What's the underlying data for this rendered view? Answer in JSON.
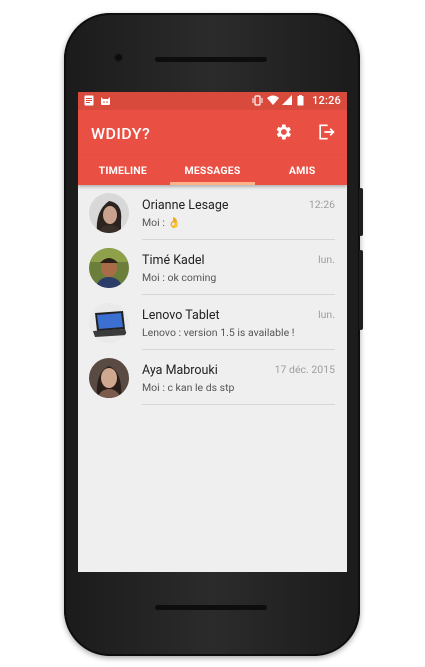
{
  "status": {
    "time": "12:26"
  },
  "app": {
    "title": "WDIDY?"
  },
  "tabs": [
    {
      "label": "TIMELINE",
      "active": false
    },
    {
      "label": "MESSAGES",
      "active": true
    },
    {
      "label": "AMIS",
      "active": false
    }
  ],
  "conversations": [
    {
      "name": "Orianne Lesage",
      "preview": "Moi : 👌",
      "date": "12:26"
    },
    {
      "name": "Timé Kadel",
      "preview": "Moi : ok coming",
      "date": "lun."
    },
    {
      "name": "Lenovo Tablet",
      "preview": "Lenovo : version 1.5 is available !",
      "date": "lun."
    },
    {
      "name": "Aya Mabrouki",
      "preview": "Moi : c kan le ds stp",
      "date": "17 déc. 2015"
    }
  ],
  "colors": {
    "primary": "#e94f42",
    "status_bar": "#d84a3c",
    "tab_indicator": "#ffb38a"
  }
}
